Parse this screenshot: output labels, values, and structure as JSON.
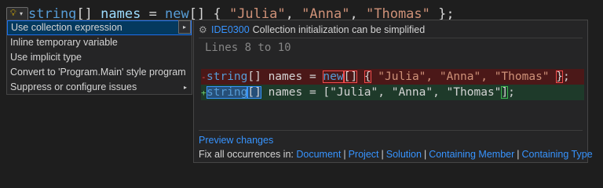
{
  "editor": {
    "code_tokens": {
      "type": "string",
      "brackets": "[] ",
      "names": "names",
      "eq": " = ",
      "new": "new",
      "open": "[] { ",
      "s1": "\"Julia\"",
      "c1": ", ",
      "s2": "\"Anna\"",
      "c2": ", ",
      "s3": "\"Thomas\"",
      "close": " };"
    }
  },
  "menu": {
    "items": [
      {
        "label": "Use collection expression",
        "has_submenu": true,
        "selected": true
      },
      {
        "label": "Inline temporary variable",
        "has_submenu": false
      },
      {
        "label": "Use implicit type",
        "has_submenu": false
      },
      {
        "label": "Convert to 'Program.Main' style program",
        "has_submenu": false
      },
      {
        "label": "Suppress or configure issues",
        "has_submenu": true
      }
    ],
    "arrow_glyph": "▸"
  },
  "preview": {
    "diagnostic_icon": "gear-icon",
    "diagnostic_code": "IDE0300",
    "diagnostic_message": "Collection initialization can be simplified",
    "lines_label": "Lines 8 to 10",
    "removed_marker": "-",
    "added_marker": "+",
    "removed": {
      "type": "string",
      "rest1": "[] names = ",
      "new": "new",
      "bracket": "[]",
      "sp": " ",
      "brace_open": "{",
      "strings": " \"Julia\", \"Anna\", \"Thomas\"",
      "sp2": " ",
      "brace_close": "}",
      "semi": ";"
    },
    "added": {
      "type": "string",
      "brackets": "[]",
      "rest": " names = [\"Julia\", \"Anna\", \"Thomas\"",
      "close": "]",
      "semi": ";"
    },
    "preview_changes": "Preview changes",
    "fix_all_label": "Fix all occurrences in:",
    "fix_all_scopes": [
      "Document",
      "Project",
      "Solution",
      "Containing Member",
      "Containing Type"
    ],
    "separator": "|"
  },
  "colors": {
    "link": "#3794ff",
    "selection": "#04395e",
    "removed_bg": "#4b1818",
    "added_bg": "#1e3a2a"
  }
}
